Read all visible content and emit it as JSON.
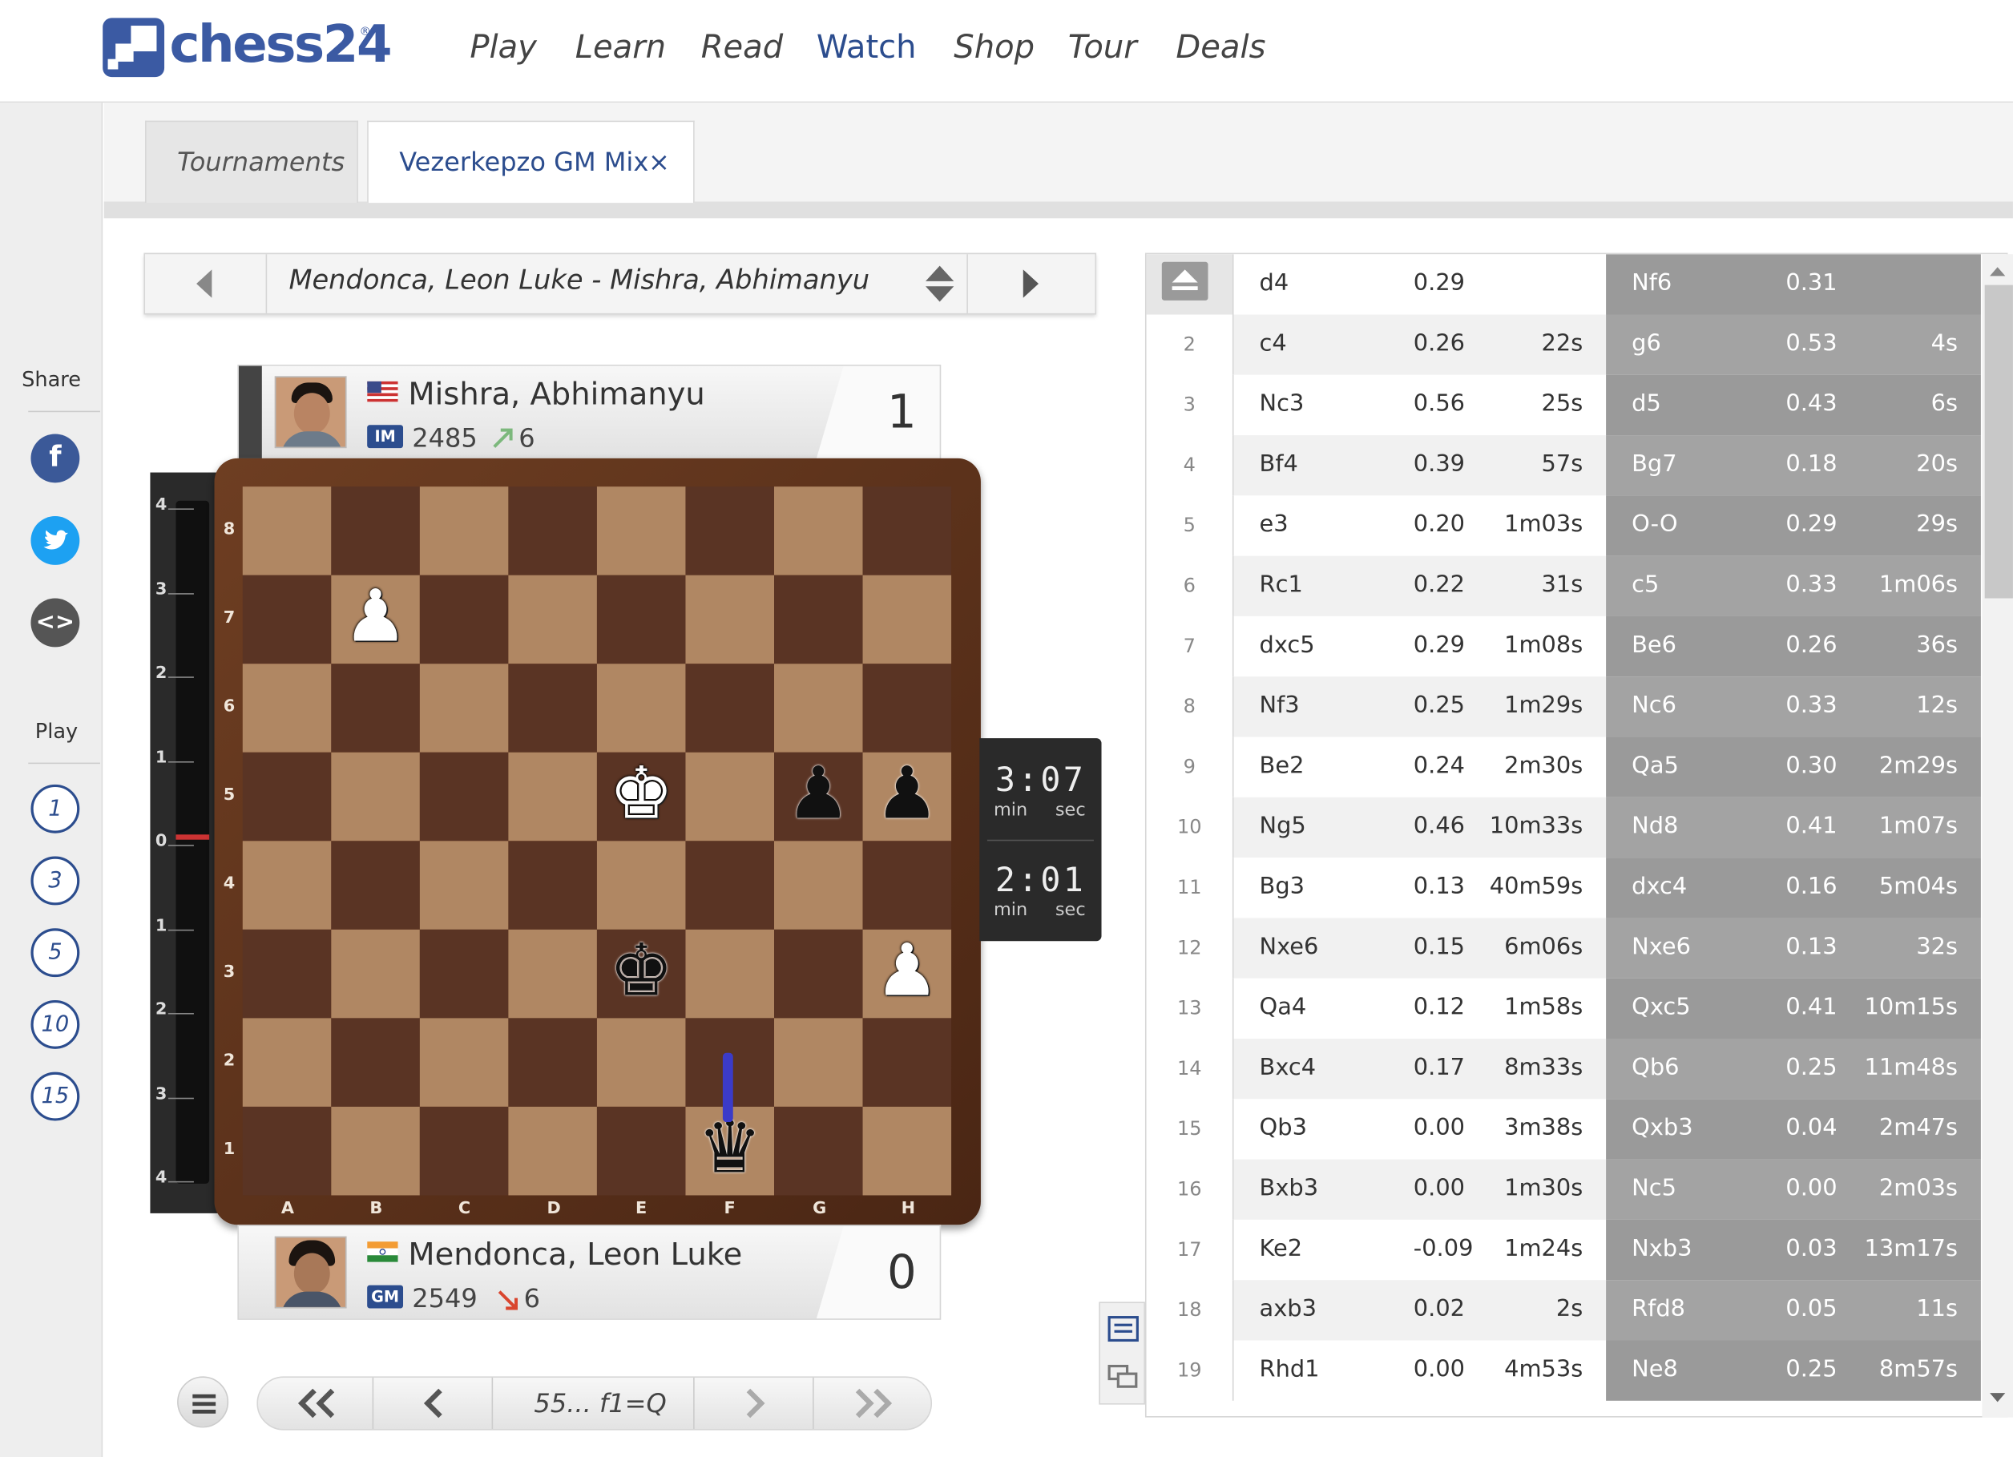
{
  "header": {
    "logo_text": "chess24",
    "logo_reg": "®",
    "nav": [
      "Play",
      "Learn",
      "Read",
      "Watch",
      "Shop",
      "Tour",
      "Deals"
    ],
    "active_nav": "Watch"
  },
  "sidebar": {
    "share_label": "Share",
    "play_label": "Play",
    "social": [
      {
        "icon": "facebook-icon",
        "glyph": "f",
        "color": "#3b5998"
      },
      {
        "icon": "twitter-icon",
        "glyph": "t",
        "color": "#1da1f2"
      },
      {
        "icon": "embed-icon",
        "glyph": "<>",
        "color": "#555555"
      }
    ],
    "play_options": [
      "1",
      "3",
      "5",
      "10",
      "15"
    ]
  },
  "tabs": {
    "tournaments": "Tournaments",
    "current": "Vezerkepzo GM Mix",
    "close": "×"
  },
  "game_selector": {
    "title": "Mendonca, Leon Luke - Mishra, Abhimanyu"
  },
  "top_player": {
    "name": "Mishra, Abhimanyu",
    "title": "IM",
    "rating": "2485",
    "delta": "6",
    "delta_dir": "up",
    "score": "1",
    "flag": "us-flag-icon"
  },
  "bottom_player": {
    "name": "Mendonca, Leon Luke",
    "title": "GM",
    "rating": "2549",
    "delta": "6",
    "delta_dir": "down",
    "score": "0",
    "flag": "india-flag-icon"
  },
  "eval_bar": {
    "ticks": [
      "4",
      "3",
      "2",
      "1",
      "0",
      "1",
      "2",
      "3",
      "4"
    ],
    "value": 0
  },
  "board": {
    "files": [
      "A",
      "B",
      "C",
      "D",
      "E",
      "F",
      "G",
      "H"
    ],
    "ranks": [
      "8",
      "7",
      "6",
      "5",
      "4",
      "3",
      "2",
      "1"
    ],
    "pieces": [
      {
        "sq": "b7",
        "glyph": "♟",
        "color": "w",
        "name": "white-pawn-b7"
      },
      {
        "sq": "e5",
        "glyph": "♚",
        "color": "w",
        "name": "white-king-e5"
      },
      {
        "sq": "g5",
        "glyph": "♟",
        "color": "b",
        "name": "black-pawn-g5"
      },
      {
        "sq": "h5",
        "glyph": "♟",
        "color": "b",
        "name": "black-pawn-h5"
      },
      {
        "sq": "e3",
        "glyph": "♚",
        "color": "b",
        "name": "black-king-e3"
      },
      {
        "sq": "h3",
        "glyph": "♟",
        "color": "w",
        "name": "white-pawn-h3"
      },
      {
        "sq": "f1",
        "glyph": "♛",
        "color": "b",
        "name": "black-queen-f1"
      }
    ]
  },
  "clock": {
    "top_time": "3:07",
    "bottom_time": "2:01",
    "min": "min",
    "sec": "sec"
  },
  "controls": {
    "current_move": "55... f1=Q"
  },
  "moves": [
    {
      "n": "",
      "w": "d4",
      "we": "0.29",
      "wt": "",
      "b": "Nf6",
      "be": "0.31",
      "bt": ""
    },
    {
      "n": "2",
      "w": "c4",
      "we": "0.26",
      "wt": "22s",
      "b": "g6",
      "be": "0.53",
      "bt": "4s"
    },
    {
      "n": "3",
      "w": "Nc3",
      "we": "0.56",
      "wt": "25s",
      "b": "d5",
      "be": "0.43",
      "bt": "6s"
    },
    {
      "n": "4",
      "w": "Bf4",
      "we": "0.39",
      "wt": "57s",
      "b": "Bg7",
      "be": "0.18",
      "bt": "20s"
    },
    {
      "n": "5",
      "w": "e3",
      "we": "0.20",
      "wt": "1m03s",
      "b": "O-O",
      "be": "0.29",
      "bt": "29s"
    },
    {
      "n": "6",
      "w": "Rc1",
      "we": "0.22",
      "wt": "31s",
      "b": "c5",
      "be": "0.33",
      "bt": "1m06s"
    },
    {
      "n": "7",
      "w": "dxc5",
      "we": "0.29",
      "wt": "1m08s",
      "b": "Be6",
      "be": "0.26",
      "bt": "36s"
    },
    {
      "n": "8",
      "w": "Nf3",
      "we": "0.25",
      "wt": "1m29s",
      "b": "Nc6",
      "be": "0.33",
      "bt": "12s"
    },
    {
      "n": "9",
      "w": "Be2",
      "we": "0.24",
      "wt": "2m30s",
      "b": "Qa5",
      "be": "0.30",
      "bt": "2m29s"
    },
    {
      "n": "10",
      "w": "Ng5",
      "we": "0.46",
      "wt": "10m33s",
      "b": "Nd8",
      "be": "0.41",
      "bt": "1m07s"
    },
    {
      "n": "11",
      "w": "Bg3",
      "we": "0.13",
      "wt": "40m59s",
      "b": "dxc4",
      "be": "0.16",
      "bt": "5m04s"
    },
    {
      "n": "12",
      "w": "Nxe6",
      "we": "0.15",
      "wt": "6m06s",
      "b": "Nxe6",
      "be": "0.13",
      "bt": "32s"
    },
    {
      "n": "13",
      "w": "Qa4",
      "we": "0.12",
      "wt": "1m58s",
      "b": "Qxc5",
      "be": "0.41",
      "bt": "10m15s"
    },
    {
      "n": "14",
      "w": "Bxc4",
      "we": "0.17",
      "wt": "8m33s",
      "b": "Qb6",
      "be": "0.25",
      "bt": "11m48s"
    },
    {
      "n": "15",
      "w": "Qb3",
      "we": "0.00",
      "wt": "3m38s",
      "b": "Qxb3",
      "be": "0.04",
      "bt": "2m47s"
    },
    {
      "n": "16",
      "w": "Bxb3",
      "we": "0.00",
      "wt": "1m30s",
      "b": "Nc5",
      "be": "0.00",
      "bt": "2m03s"
    },
    {
      "n": "17",
      "w": "Ke2",
      "we": "-0.09",
      "wt": "1m24s",
      "b": "Nxb3",
      "be": "0.03",
      "bt": "13m17s"
    },
    {
      "n": "18",
      "w": "axb3",
      "we": "0.02",
      "wt": "2s",
      "b": "Rfd8",
      "be": "0.05",
      "bt": "11s"
    },
    {
      "n": "19",
      "w": "Rhd1",
      "we": "0.00",
      "wt": "4m53s",
      "b": "Ne8",
      "be": "0.25",
      "bt": "8m57s"
    }
  ],
  "colors": {
    "brand": "#3b5aa3",
    "nav_active": "#2c4d8e",
    "black_move_bg": "#9a9a9a",
    "white_move_bg_alt": "#f1f1f1"
  }
}
